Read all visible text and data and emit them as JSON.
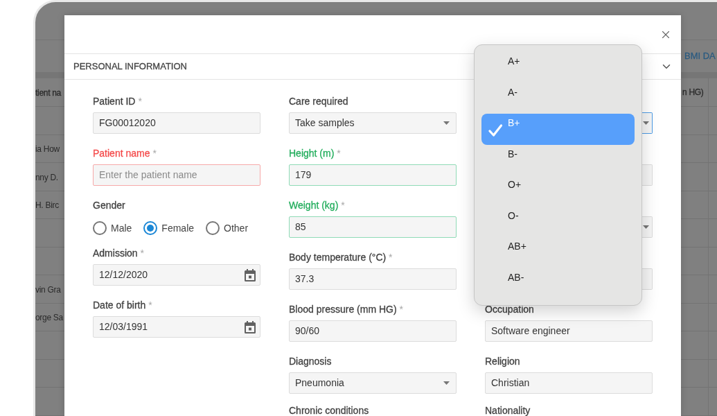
{
  "app_background": {
    "tabs": [
      {
        "label": "BMI DA"
      }
    ],
    "table": {
      "columns": [
        "tient na",
        "n HG)"
      ],
      "rows": [
        {},
        {
          "column_1": "ia How"
        },
        {
          "column_1": "nny D."
        },
        {
          "column_1": "H. Birc"
        },
        {},
        {},
        {
          "column_1": "vin Gra"
        },
        {
          "column_1": "orge Sa"
        },
        {},
        {},
        {}
      ]
    }
  },
  "dialog": {
    "section": {
      "title": "PERSONAL INFORMATION",
      "expanded": true
    },
    "form_columns": [
      {
        "fields": [
          {
            "kind": "input",
            "label": "Patient ID",
            "required_mark": "*",
            "value": "FG00012020",
            "error": false,
            "valid": false
          },
          {
            "kind": "input",
            "label": "Patient name",
            "required_mark": "*",
            "placeholder": "Enter the patient name",
            "error": true,
            "valid": false
          },
          {
            "kind": "radio",
            "label": "Gender",
            "options": [
              {
                "label": "Male",
                "selected": false
              },
              {
                "label": "Female",
                "selected": true
              },
              {
                "label": "Other",
                "selected": false
              }
            ]
          },
          {
            "kind": "date",
            "label": "Admission",
            "required_mark": "*",
            "value": "12/12/2020",
            "error": false,
            "valid": false
          },
          {
            "kind": "date",
            "label": "Date of birth",
            "required_mark": "*",
            "value": "12/03/1991",
            "error": false,
            "valid": false
          }
        ]
      },
      {
        "fields": [
          {
            "kind": "select",
            "label": "Care required",
            "value": "Take samples",
            "error": false,
            "valid": false
          },
          {
            "kind": "input",
            "label": "Height (m)",
            "required_mark": "*",
            "value": "179",
            "error": false,
            "valid": true
          },
          {
            "kind": "input",
            "label": "Weight (kg)",
            "required_mark": "*",
            "value": "85",
            "error": false,
            "valid": true
          },
          {
            "kind": "input",
            "label": "Body temperature (°C)",
            "required_mark": "*",
            "value": "37.3",
            "error": false,
            "valid": false
          },
          {
            "kind": "input",
            "label": "Blood pressure (mm HG)",
            "required_mark": "*",
            "value": "90/60",
            "error": false,
            "valid": false
          },
          {
            "kind": "select",
            "label": "Diagnosis",
            "value": "Pneumonia",
            "error": false,
            "valid": false
          },
          {
            "kind": "label_only",
            "label": "Chronic conditions"
          }
        ]
      },
      {
        "fields": [
          {
            "kind": "select",
            "focused": true
          },
          {
            "kind": "input",
            "focused": false
          },
          {
            "kind": "select",
            "focused": false
          },
          {
            "kind": "input",
            "focused": false
          },
          {
            "kind": "input",
            "label": "Occupation",
            "value": "Software engineer",
            "error": false,
            "valid": false
          },
          {
            "kind": "input",
            "label": "Religion",
            "value": "Christian",
            "error": false,
            "valid": false
          },
          {
            "kind": "label_only",
            "label": "Nationality"
          }
        ]
      }
    ]
  },
  "blood_type_menu": {
    "options": [
      {
        "label": "A+",
        "selected": false
      },
      {
        "label": "A-",
        "selected": false
      },
      {
        "label": "B+",
        "selected": true
      },
      {
        "label": "B-",
        "selected": false
      },
      {
        "label": "O+",
        "selected": false
      },
      {
        "label": "O-",
        "selected": false
      },
      {
        "label": "AB+",
        "selected": false
      },
      {
        "label": "AB-",
        "selected": false
      }
    ]
  }
}
